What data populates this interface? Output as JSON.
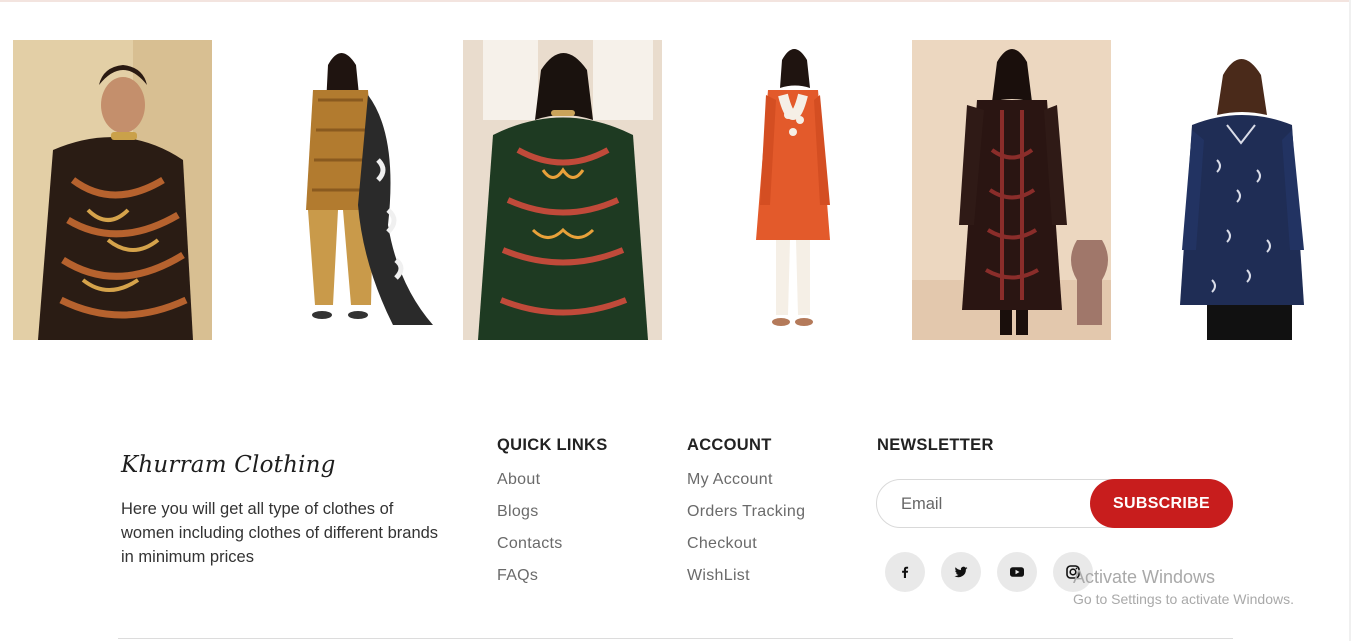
{
  "gallery": {
    "items": [
      {
        "alt": "product-1",
        "bg": "#e3cfa6",
        "garment": "#2a1c14",
        "accent": "#b6622e"
      },
      {
        "alt": "product-2",
        "bg": "#ffffff",
        "garment": "#b27b2f",
        "accent": "#2a2a2a"
      },
      {
        "alt": "product-3",
        "bg": "#e9dccd",
        "garment": "#1e3a22",
        "accent": "#c04a3a"
      },
      {
        "alt": "product-4",
        "bg": "#ffffff",
        "garment": "#e35a2b",
        "accent": "#f5efe6"
      },
      {
        "alt": "product-5",
        "bg": "#ecd7c0",
        "garment": "#2a1512",
        "accent": "#8a2d2a"
      },
      {
        "alt": "product-6",
        "bg": "#ffffff",
        "garment": "#1f2d55",
        "accent": "#d9dce8"
      }
    ]
  },
  "footer": {
    "brand": "Khurram Clothing",
    "about": "Here you will get all type of clothes of women including clothes of different brands in minimum prices",
    "quick_links": {
      "title": "QUICK LINKS",
      "items": [
        "About",
        "Blogs",
        "Contacts",
        "FAQs"
      ]
    },
    "account": {
      "title": "ACCOUNT",
      "items": [
        "My Account",
        "Orders Tracking",
        "Checkout",
        "WishList"
      ]
    },
    "newsletter": {
      "title": "NEWSLETTER",
      "placeholder": "Email",
      "button": "SUBSCRIBE"
    },
    "social": [
      {
        "name": "facebook-icon"
      },
      {
        "name": "twitter-icon"
      },
      {
        "name": "youtube-icon"
      },
      {
        "name": "instagram-icon"
      }
    ]
  },
  "watermark": {
    "title": "Activate Windows",
    "subtitle": "Go to Settings to activate Windows."
  },
  "colors": {
    "accent": "#c81d1d",
    "social_bg": "#e9e9e9"
  }
}
